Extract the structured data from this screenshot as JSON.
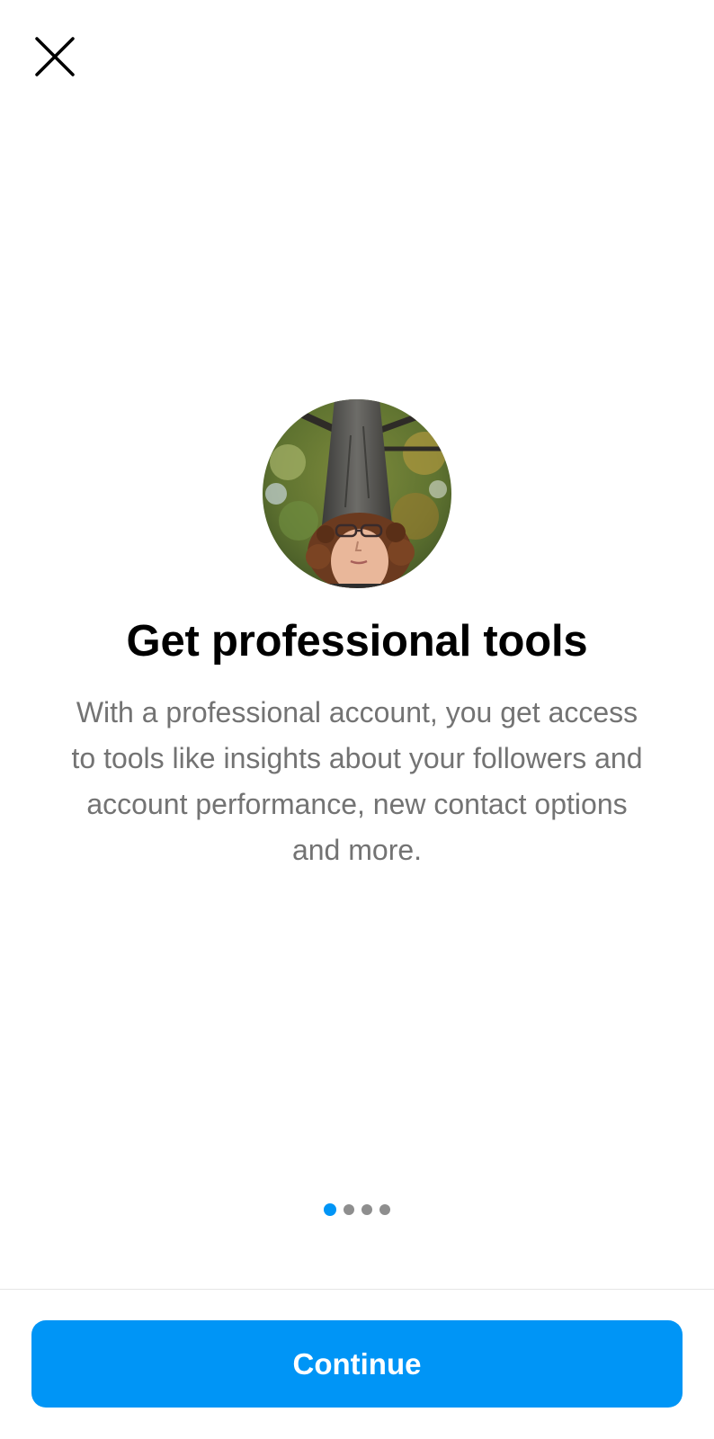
{
  "header": {
    "close_icon": "close-icon"
  },
  "main": {
    "avatar_icon": "profile-photo",
    "title": "Get professional tools",
    "description": "With a professional account, you get access to tools like insights about your followers and account performance, new contact options and more."
  },
  "pager": {
    "total": 4,
    "active_index": 0
  },
  "footer": {
    "continue_label": "Continue"
  },
  "colors": {
    "accent": "#0095f6",
    "text_primary": "#000000",
    "text_secondary": "#737373",
    "dot_inactive": "#8e8e8e"
  }
}
